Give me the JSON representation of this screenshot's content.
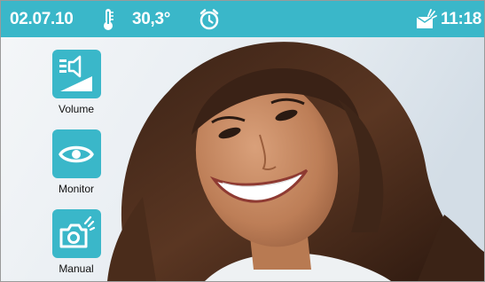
{
  "status_bar": {
    "date": "02.07.10",
    "temperature": "30,3°",
    "time": "11:18",
    "icons": [
      "thermometer-icon",
      "alarm-clock-icon",
      "message-icon"
    ]
  },
  "sidebar": {
    "items": [
      {
        "label": "Volume",
        "icon": "volume-icon"
      },
      {
        "label": "Monitor",
        "icon": "eye-icon"
      },
      {
        "label": "Manual",
        "icon": "camera-icon"
      }
    ]
  },
  "colors": {
    "accent": "#3ab7c9",
    "text_on_accent": "#ffffff",
    "label_text": "#111111"
  }
}
